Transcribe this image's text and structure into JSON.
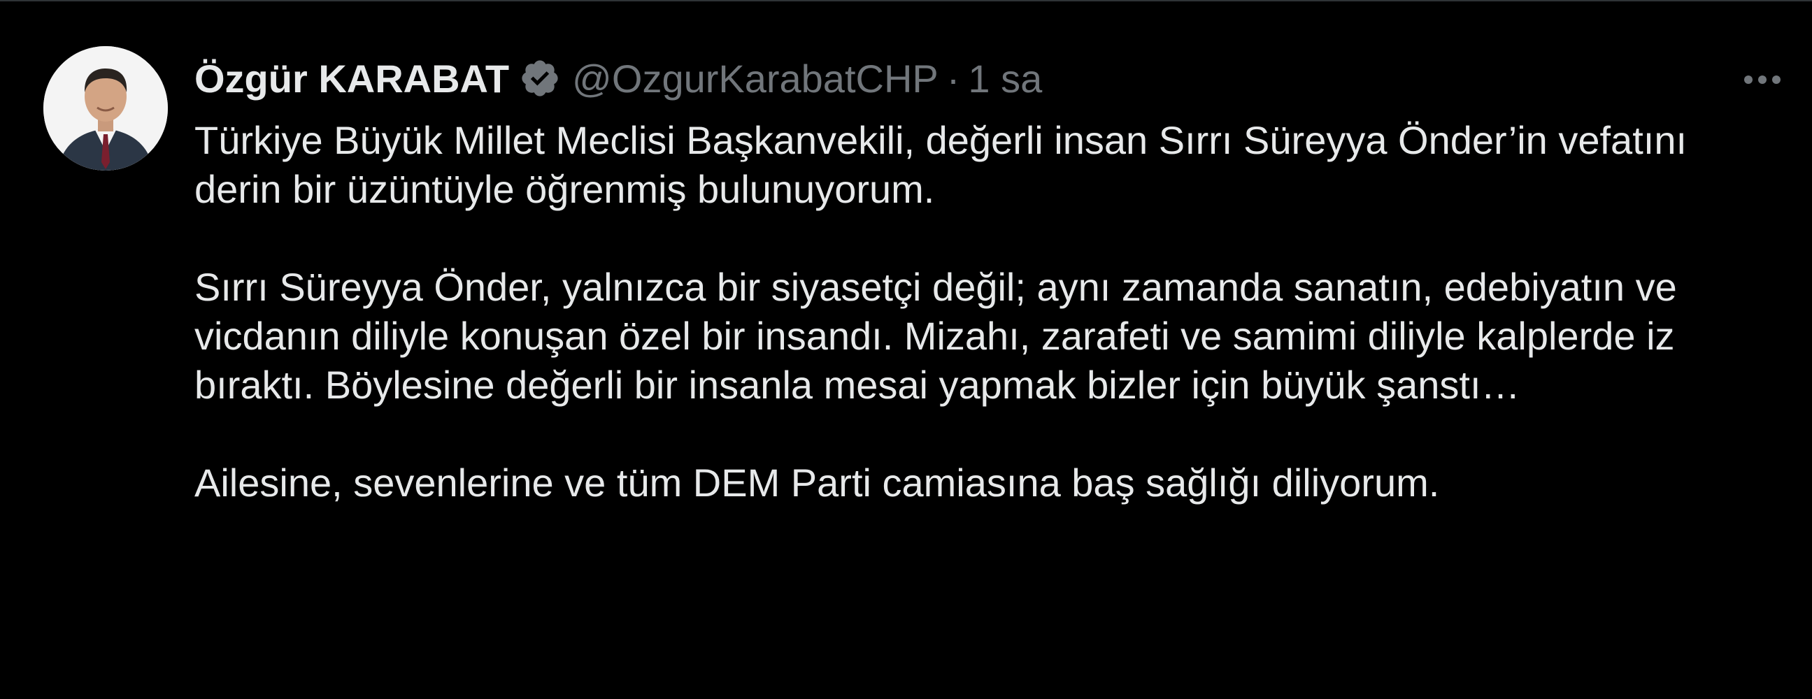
{
  "tweet": {
    "author": {
      "display_name": "Özgür KARABAT",
      "handle": "@OzgurKarabatCHP",
      "verified": true,
      "avatar_icon": "profile-photo"
    },
    "separator": "·",
    "time": "1 sa",
    "more_icon": "more-horizontal-icon",
    "paragraphs": [
      "Türkiye Büyük Millet Meclisi Başkanvekili, değerli insan Sırrı Süreyya Önder’in vefatını derin bir üzüntüyle öğrenmiş bulunuyorum.",
      "Sırrı Süreyya Önder, yalnızca bir siyasetçi değil; aynı zamanda sanatın, edebiyatın ve vicdanın diliyle konuşan özel bir insandı. Mizahı, zarafeti ve samimi diliyle kalplerde iz bıraktı. Böylesine değerli bir insanla mesai yapmak bizler için büyük şanstı…",
      "Ailesine, sevenlerine ve tüm DEM Parti camiasına baş sağlığı diliyorum."
    ]
  },
  "colors": {
    "background": "#000000",
    "text_primary": "#e7e9ea",
    "text_secondary": "#71767b",
    "verified_badge": "#71767b",
    "border": "#2f3336"
  }
}
